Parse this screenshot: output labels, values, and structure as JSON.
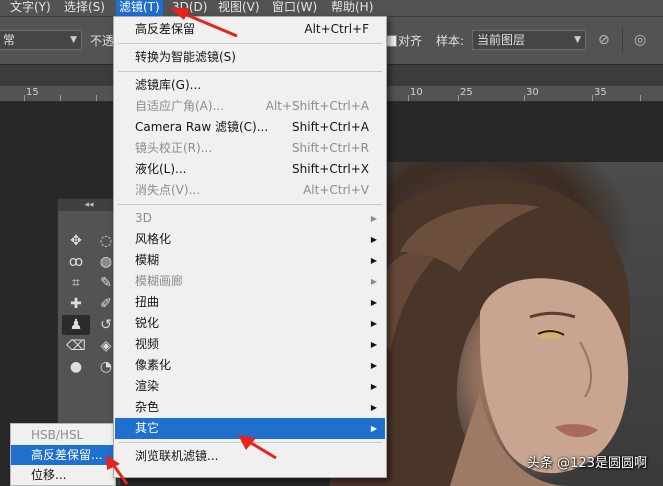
{
  "menubar": {
    "items": [
      "文字(Y)",
      "选择(S)",
      "滤镜(T)",
      "3D(D)",
      "视图(V)",
      "窗口(W)",
      "帮助(H)"
    ],
    "active_index": 2
  },
  "optionsbar": {
    "mode_value": "常",
    "opacity_label": "不透",
    "align_label": "对齐",
    "sample_label": "样本:",
    "sample_value": "当前图层"
  },
  "ruler": {
    "labels": [
      "15",
      "10",
      "25",
      "30",
      "35"
    ]
  },
  "filter_menu": {
    "items": [
      {
        "label": "高反差保留",
        "shortcut": "Alt+Ctrl+F",
        "enabled": true
      },
      {
        "separator": true
      },
      {
        "label": "转换为智能滤镜(S)",
        "enabled": true
      },
      {
        "separator": true
      },
      {
        "label": "滤镜库(G)...",
        "enabled": true
      },
      {
        "label": "自适应广角(A)...",
        "shortcut": "Alt+Shift+Ctrl+A",
        "enabled": false
      },
      {
        "label": "Camera Raw 滤镜(C)...",
        "shortcut": "Shift+Ctrl+A",
        "enabled": true
      },
      {
        "label": "镜头校正(R)...",
        "shortcut": "Shift+Ctrl+R",
        "enabled": false
      },
      {
        "label": "液化(L)...",
        "shortcut": "Shift+Ctrl+X",
        "enabled": true
      },
      {
        "label": "消失点(V)...",
        "shortcut": "Alt+Ctrl+V",
        "enabled": false
      },
      {
        "separator": true
      },
      {
        "label": "3D",
        "submenu": true,
        "enabled": false
      },
      {
        "label": "风格化",
        "submenu": true,
        "enabled": true
      },
      {
        "label": "模糊",
        "submenu": true,
        "enabled": true
      },
      {
        "label": "模糊画廊",
        "submenu": true,
        "enabled": false
      },
      {
        "label": "扭曲",
        "submenu": true,
        "enabled": true
      },
      {
        "label": "锐化",
        "submenu": true,
        "enabled": true
      },
      {
        "label": "视频",
        "submenu": true,
        "enabled": true
      },
      {
        "label": "像素化",
        "submenu": true,
        "enabled": true
      },
      {
        "label": "渲染",
        "submenu": true,
        "enabled": true
      },
      {
        "label": "杂色",
        "submenu": true,
        "enabled": true
      },
      {
        "label": "其它",
        "submenu": true,
        "enabled": true,
        "highlighted": true
      },
      {
        "separator": true
      },
      {
        "label": "浏览联机滤镜...",
        "enabled": true
      }
    ]
  },
  "other_submenu": {
    "items": [
      {
        "label": "HSB/HSL",
        "enabled": false
      },
      {
        "label": "高反差保留...",
        "enabled": true,
        "highlighted": true
      },
      {
        "label": "位移...",
        "enabled": true
      }
    ]
  },
  "toolbox": {
    "collapse_glyph": "◂◂",
    "tools": [
      {
        "name": "move-tool-icon",
        "glyph": "✥"
      },
      {
        "name": "ellipse-marquee-icon",
        "glyph": "◌"
      },
      {
        "name": "lasso-icon",
        "glyph": "ꝏ"
      },
      {
        "name": "quick-select-icon",
        "glyph": "◍"
      },
      {
        "name": "crop-icon",
        "glyph": "⌗"
      },
      {
        "name": "eyedropper-icon",
        "glyph": "✎"
      },
      {
        "name": "healing-brush-icon",
        "glyph": "✚"
      },
      {
        "name": "brush-icon",
        "glyph": "✐"
      },
      {
        "name": "clone-stamp-icon",
        "glyph": "♟",
        "selected": true
      },
      {
        "name": "history-brush-icon",
        "glyph": "↺"
      },
      {
        "name": "eraser-icon",
        "glyph": "⌫"
      },
      {
        "name": "paint-bucket-icon",
        "glyph": "◈"
      },
      {
        "name": "blur-icon",
        "glyph": "●"
      },
      {
        "name": "dodge-icon",
        "glyph": "◔"
      }
    ]
  },
  "watermark": {
    "text": "头条 @123是圆圆啊"
  },
  "colors": {
    "menubar": "#535353",
    "highlight": "#1f6fcf",
    "menu_bg": "#f0f0f0",
    "canvas": "#282828",
    "arrow": "#e8231c"
  }
}
